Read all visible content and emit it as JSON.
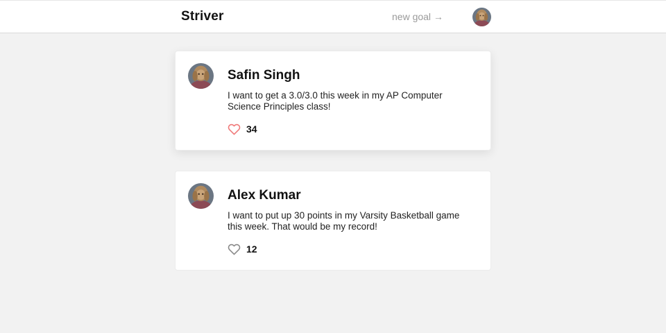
{
  "header": {
    "brand": "Striver",
    "new_goal_label": "new goal →",
    "avatar_icon": "user-avatar-icon"
  },
  "posts": [
    {
      "author": "Safin Singh",
      "text": "I want to get a 3.0/3.0 this week in my AP Computer Science Principles class!",
      "likes": "34",
      "liked": true
    },
    {
      "author": "Alex Kumar",
      "text": "I want to put up 30 points in my Varsity Basketball game this week. That would be my record!",
      "likes": "12",
      "liked": false
    }
  ],
  "colors": {
    "background": "#f2f2f2",
    "card": "#ffffff",
    "heart_liked": "#f07a7a",
    "heart_default": "#8a8a8a",
    "muted_text": "#9a9a9a"
  }
}
